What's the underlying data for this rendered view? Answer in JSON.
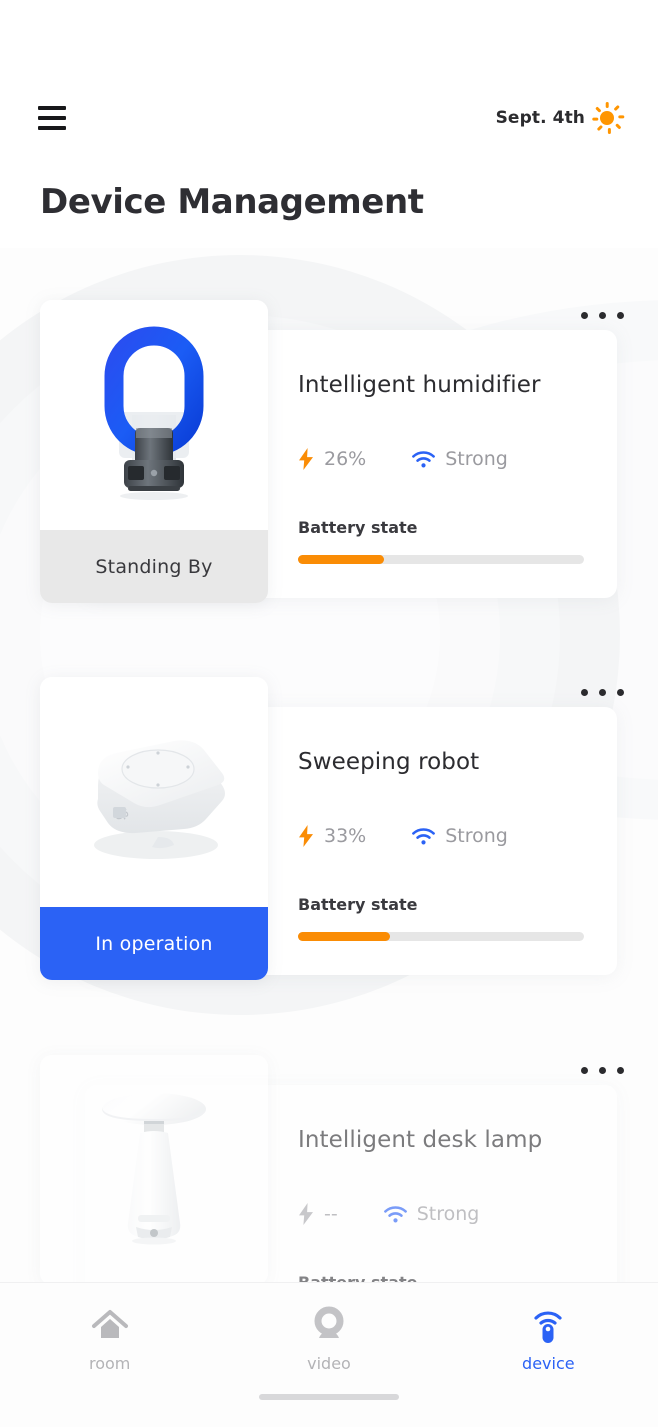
{
  "header": {
    "menu_icon": "hamburger-icon",
    "date": "Sept. 4th",
    "weather_icon": "sun-icon",
    "title": "Device Management"
  },
  "common": {
    "battery_label": "Battery state",
    "more_icon": "ellipsis-icon",
    "bolt_icon": "lightning-bolt-icon",
    "wifi_icon": "wifi-icon",
    "accent_blue": "#2b62f5",
    "accent_orange": "#fa8c05",
    "idle_badge_bg": "#e8e8e8"
  },
  "devices": [
    {
      "name": "Intelligent humidifier",
      "status": "Standing By",
      "status_type": "idle",
      "battery": "26%",
      "battery_pct": 30,
      "signal": "Strong",
      "battery_label": "Battery state",
      "thumb_icon": "humidifier-image",
      "dimmed": false
    },
    {
      "name": "Sweeping robot",
      "status": "In operation",
      "status_type": "active",
      "battery": "33%",
      "battery_pct": 32,
      "signal": "Strong",
      "battery_label": "Battery state",
      "thumb_icon": "sweeping-robot-image",
      "dimmed": false
    },
    {
      "name": "Intelligent desk lamp",
      "status": "",
      "status_type": "none",
      "battery": "--",
      "battery_pct": 0,
      "signal": "Strong",
      "battery_label": "Battery state",
      "thumb_icon": "desk-lamp-image",
      "dimmed": true
    }
  ],
  "bottom_nav": {
    "items": [
      {
        "label": "room",
        "icon": "home-icon",
        "active": false
      },
      {
        "label": "video",
        "icon": "camera-icon",
        "active": false
      },
      {
        "label": "device",
        "icon": "remote-device-icon",
        "active": true
      }
    ]
  }
}
